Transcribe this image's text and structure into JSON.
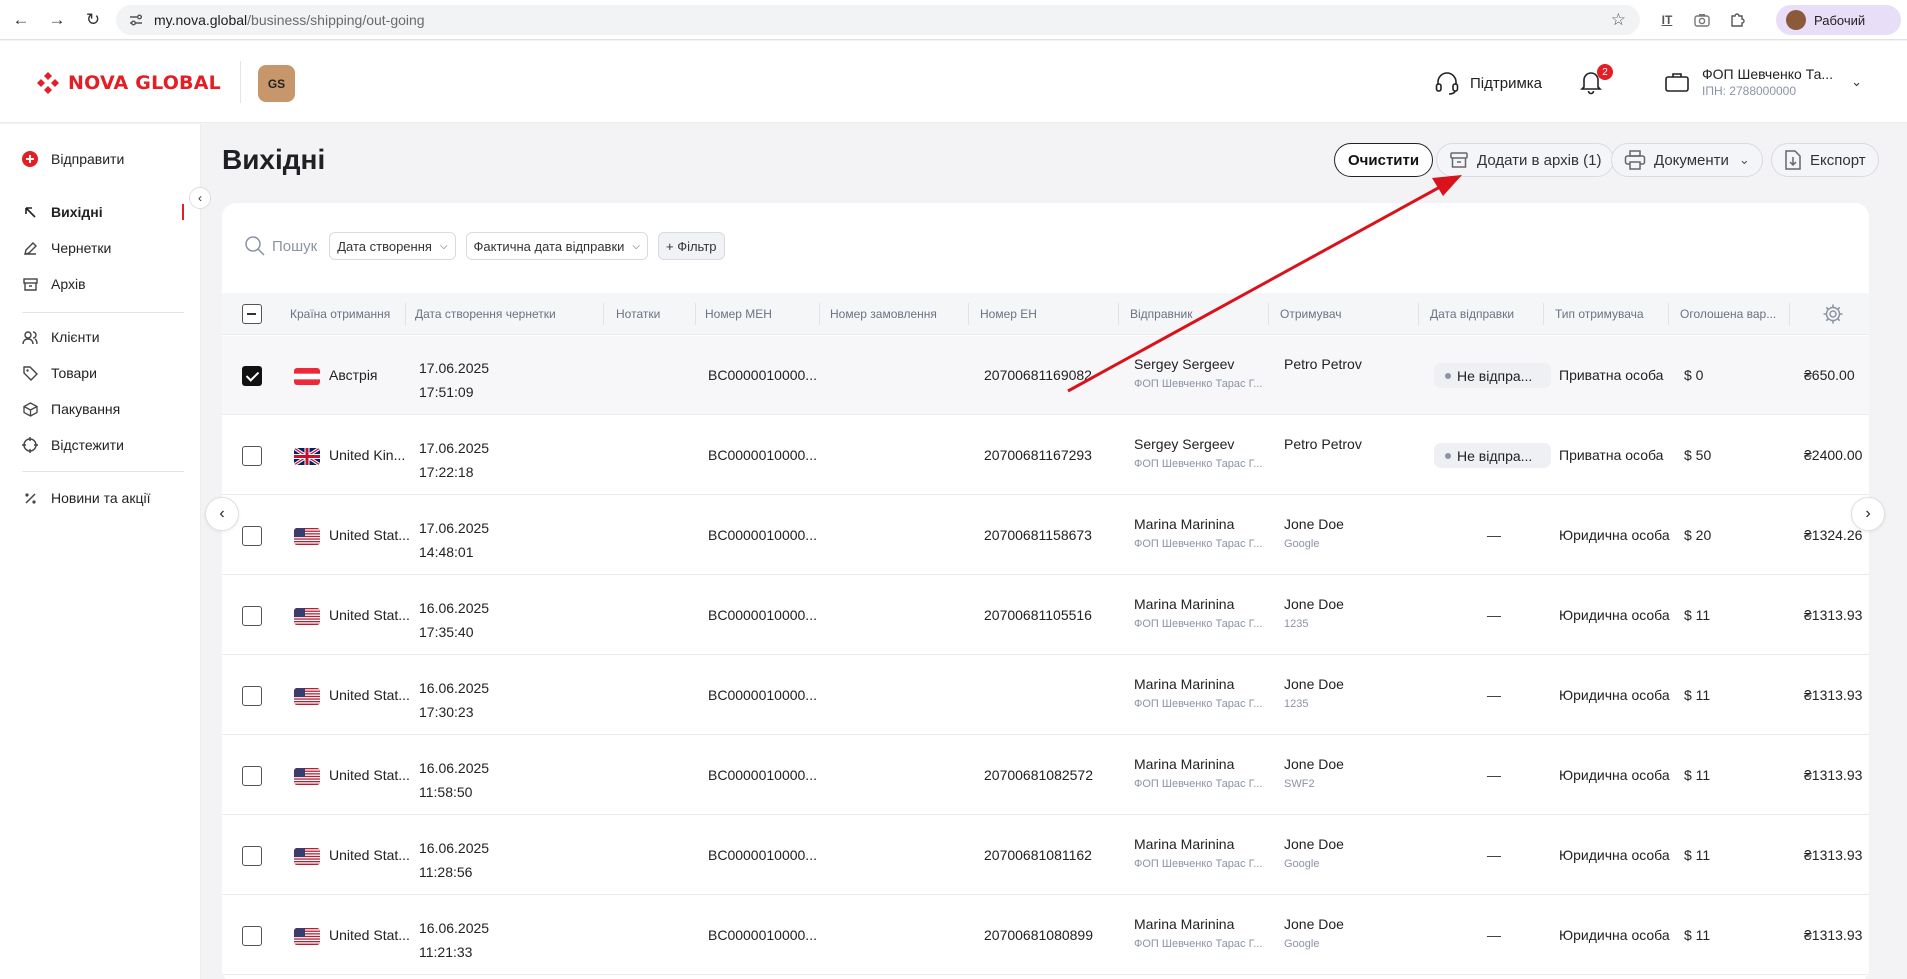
{
  "browser": {
    "url_host": "my.nova.global",
    "url_path": "/business/shipping/out-going",
    "profile_label": "Рабочий"
  },
  "header": {
    "logo_text": "NOVA GLOBAL",
    "badge_text": "GS",
    "support_label": "Підтримка",
    "notification_count": "2",
    "account_name": "ФОП Шевченко Та...",
    "account_inn": "ІПН: 2788000000"
  },
  "sidebar": {
    "items": [
      {
        "label": "Відправити",
        "icon": "plus-circle-icon"
      },
      {
        "label": "Вихідні",
        "icon": "arrow-up-left-icon"
      },
      {
        "label": "Чернетки",
        "icon": "pencil-icon"
      },
      {
        "label": "Архів",
        "icon": "archive-icon"
      },
      {
        "label": "Клієнти",
        "icon": "users-icon"
      },
      {
        "label": "Товари",
        "icon": "tag-icon"
      },
      {
        "label": "Пакування",
        "icon": "box-icon"
      },
      {
        "label": "Відстежити",
        "icon": "crosshair-icon"
      },
      {
        "label": "Новини та акції",
        "icon": "percent-icon"
      }
    ]
  },
  "page": {
    "title": "Вихідні",
    "actions": {
      "clear": "Очистити",
      "archive": "Додати в архів (1)",
      "documents": "Документи",
      "export": "Експорт"
    }
  },
  "filters": {
    "search_placeholder": "Пошук",
    "created_date": "Дата створення",
    "actual_ship_date": "Фактична дата відправки",
    "add_filter": "+ Фільтр"
  },
  "table": {
    "columns": [
      "Країна отримання",
      "Дата створення чернетки",
      "Нотатки",
      "Номер МЕН",
      "Номер замовлення",
      "Номер ЕН",
      "Відправник",
      "Отримувач",
      "Дата відправки",
      "Тип отримувача",
      "Оголошена вар..."
    ],
    "rows": [
      {
        "country": "Австрія",
        "flag": "austria",
        "date": "17.06.2025",
        "time": "17:51:09",
        "men": "BC0000010000...",
        "en": "20700681169082",
        "sender": "Sergey Sergeev",
        "sender_sub": "ФОП Шевченко Тарас Г...",
        "recipient": "Petro Petrov",
        "recipient_sub": "",
        "ship_date": "Не відпра...",
        "recipient_type": "Приватна особа",
        "declared": "$ 0",
        "amount": "₴650.00",
        "checked": true
      },
      {
        "country": "United Kin...",
        "flag": "uk",
        "date": "17.06.2025",
        "time": "17:22:18",
        "men": "BC0000010000...",
        "en": "20700681167293",
        "sender": "Sergey Sergeev",
        "sender_sub": "ФОП Шевченко Тарас Г...",
        "recipient": "Petro Petrov",
        "recipient_sub": "",
        "ship_date": "Не відпра...",
        "recipient_type": "Приватна особа",
        "declared": "$ 50",
        "amount": "₴2400.00",
        "checked": false
      },
      {
        "country": "United Stat...",
        "flag": "us",
        "date": "17.06.2025",
        "time": "14:48:01",
        "men": "BC0000010000...",
        "en": "20700681158673",
        "sender": "Marina Marinina",
        "sender_sub": "ФОП Шевченко Тарас Г...",
        "recipient": "Jone Doe",
        "recipient_sub": "Google",
        "ship_date": "—",
        "recipient_type": "Юридична особа",
        "declared": "$ 20",
        "amount": "₴1324.26",
        "checked": false
      },
      {
        "country": "United Stat...",
        "flag": "us",
        "date": "16.06.2025",
        "time": "17:35:40",
        "men": "BC0000010000...",
        "en": "20700681105516",
        "sender": "Marina Marinina",
        "sender_sub": "ФОП Шевченко Тарас Г...",
        "recipient": "Jone Doe",
        "recipient_sub": "1235",
        "ship_date": "—",
        "recipient_type": "Юридична особа",
        "declared": "$ 11",
        "amount": "₴1313.93",
        "checked": false
      },
      {
        "country": "United Stat...",
        "flag": "us",
        "date": "16.06.2025",
        "time": "17:30:23",
        "men": "BC0000010000...",
        "en": "",
        "sender": "Marina Marinina",
        "sender_sub": "ФОП Шевченко Тарас Г...",
        "recipient": "Jone Doe",
        "recipient_sub": "1235",
        "ship_date": "—",
        "recipient_type": "Юридична особа",
        "declared": "$ 11",
        "amount": "₴1313.93",
        "checked": false
      },
      {
        "country": "United Stat...",
        "flag": "us",
        "date": "16.06.2025",
        "time": "11:58:50",
        "men": "BC0000010000...",
        "en": "20700681082572",
        "sender": "Marina Marinina",
        "sender_sub": "ФОП Шевченко Тарас Г...",
        "recipient": "Jone Doe",
        "recipient_sub": "SWF2",
        "ship_date": "—",
        "recipient_type": "Юридична особа",
        "declared": "$ 11",
        "amount": "₴1313.93",
        "checked": false
      },
      {
        "country": "United Stat...",
        "flag": "us",
        "date": "16.06.2025",
        "time": "11:28:56",
        "men": "BC0000010000...",
        "en": "20700681081162",
        "sender": "Marina Marinina",
        "sender_sub": "ФОП Шевченко Тарас Г...",
        "recipient": "Jone Doe",
        "recipient_sub": "Google",
        "ship_date": "—",
        "recipient_type": "Юридична особа",
        "declared": "$ 11",
        "amount": "₴1313.93",
        "checked": false
      },
      {
        "country": "United Stat...",
        "flag": "us",
        "date": "16.06.2025",
        "time": "11:21:33",
        "men": "BC0000010000...",
        "en": "20700681080899",
        "sender": "Marina Marinina",
        "sender_sub": "ФОП Шевченко Тарас Г...",
        "recipient": "Jone Doe",
        "recipient_sub": "Google",
        "ship_date": "—",
        "recipient_type": "Юридична особа",
        "declared": "$ 11",
        "amount": "₴1313.93",
        "checked": false
      }
    ]
  },
  "colors": {
    "brand_red": "#e31e24",
    "annotation_arrow": "#d9121b"
  }
}
